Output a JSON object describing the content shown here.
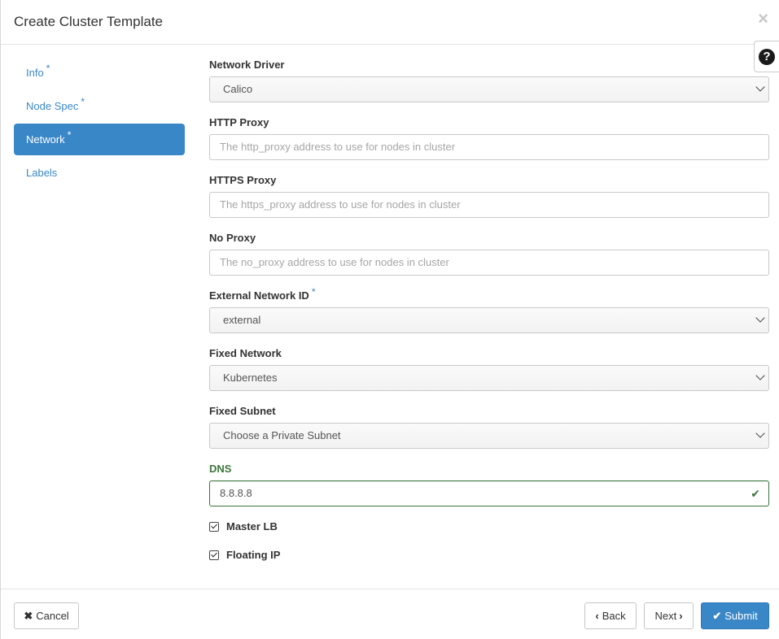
{
  "modal": {
    "title": "Create Cluster Template",
    "close_icon": "×",
    "help_icon": "?"
  },
  "nav": {
    "items": [
      {
        "label": "Info",
        "required": "*"
      },
      {
        "label": "Node Spec",
        "required": "*"
      },
      {
        "label": "Network",
        "required": "*",
        "active": true
      },
      {
        "label": "Labels"
      }
    ]
  },
  "form": {
    "network_driver": {
      "label": "Network Driver",
      "value": "Calico"
    },
    "http_proxy": {
      "label": "HTTP Proxy",
      "placeholder": "The http_proxy address to use for nodes in cluster"
    },
    "https_proxy": {
      "label": "HTTPS Proxy",
      "placeholder": "The https_proxy address to use for nodes in cluster"
    },
    "no_proxy": {
      "label": "No Proxy",
      "placeholder": "The no_proxy address to use for nodes in cluster"
    },
    "external_network": {
      "label": "External Network ID",
      "required": "*",
      "value": "external"
    },
    "fixed_network": {
      "label": "Fixed Network",
      "value": "Kubernetes"
    },
    "fixed_subnet": {
      "label": "Fixed Subnet",
      "value": "Choose a Private Subnet"
    },
    "dns": {
      "label": "DNS",
      "value": "8.8.8.8",
      "valid_icon": "✔"
    },
    "master_lb": {
      "label": "Master LB",
      "checked": true
    },
    "floating_ip": {
      "label": "Floating IP",
      "checked": true
    }
  },
  "footer": {
    "cancel_icon": "✖",
    "cancel": "Cancel",
    "back_icon": "‹",
    "back": "Back",
    "next": "Next",
    "next_icon": "›",
    "submit_icon": "✔",
    "submit": "Submit"
  },
  "colors": {
    "accent": "#3a87c8",
    "success": "#3c763d"
  }
}
